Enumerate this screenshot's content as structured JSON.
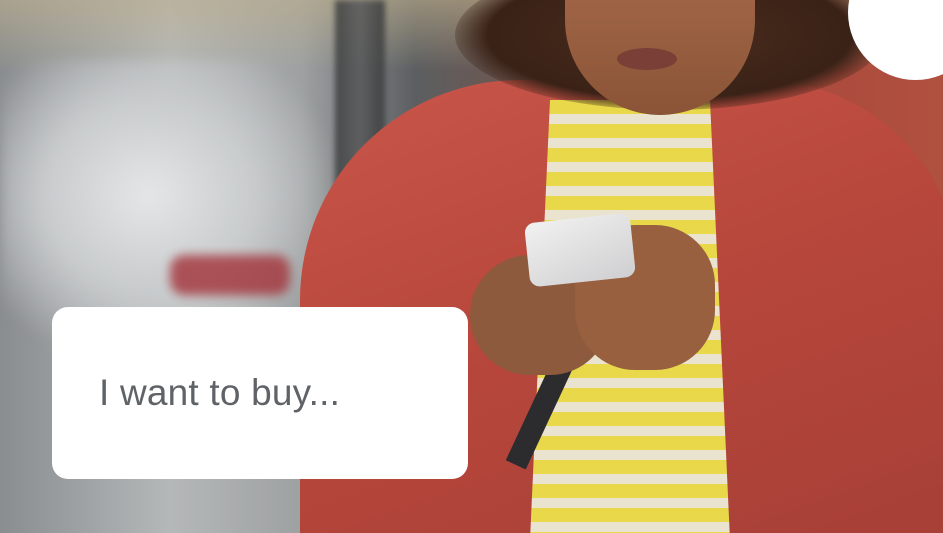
{
  "photo": {
    "subject": "woman-using-smartphone"
  },
  "card": {
    "text": "I want to buy..."
  },
  "colors": {
    "card_background": "#ffffff",
    "card_text": "#5f6368",
    "jacket": "#b8473c",
    "shirt_stripe": "#e8d84a"
  }
}
